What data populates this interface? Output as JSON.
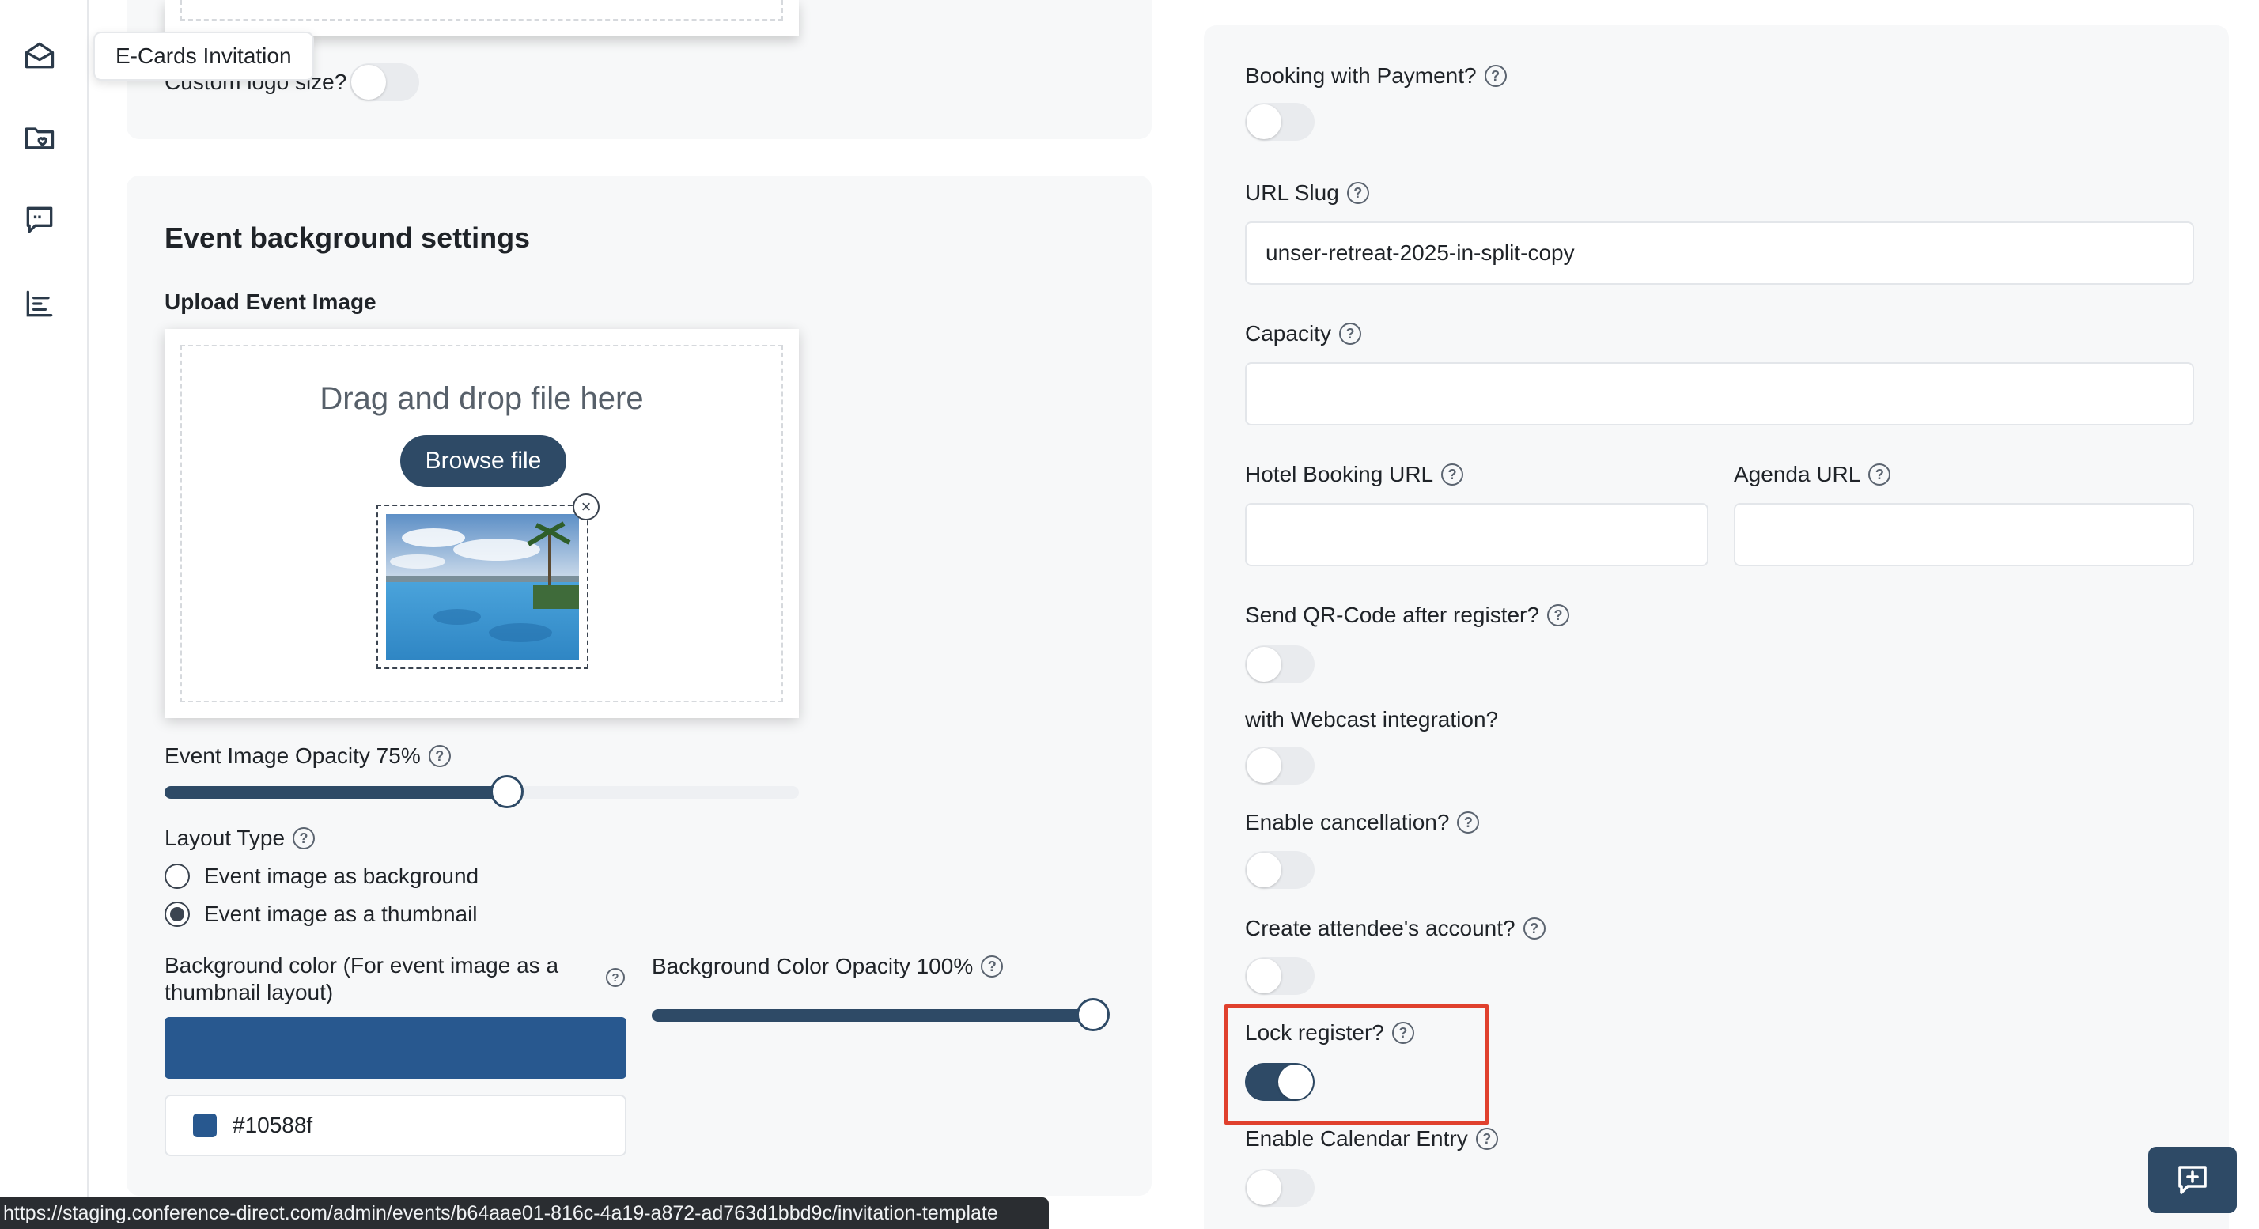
{
  "sidebar": {
    "tooltip": "E-Cards Invitation",
    "icons": [
      "envelope-open-icon",
      "folder-heart-icon",
      "chat-quote-icon",
      "chart-bars-icon"
    ]
  },
  "top_card": {
    "custom_logo_label": "Custom logo size?",
    "custom_logo_on": false
  },
  "background": {
    "title": "Event background settings",
    "upload_label": "Upload Event Image",
    "drop_text": "Drag and drop file here",
    "browse_label": "Browse file",
    "opacity_label": "Event Image Opacity 75%",
    "opacity_value": 75,
    "layout_label": "Layout Type",
    "layout_options": [
      "Event image as background",
      "Event image as a thumbnail"
    ],
    "layout_selected": 1,
    "bg_color_label": "Background color (For event image as a thumbnail layout)",
    "bg_color_value": "#10588f",
    "bg_color_swatch": "#28588f",
    "bg_opacity_label": "Background Color Opacity 100%",
    "bg_opacity_value": 100
  },
  "right": {
    "booking_payment_label": "Booking with Payment?",
    "booking_payment_on": false,
    "url_slug_label": "URL Slug",
    "url_slug_value": "unser-retreat-2025-in-split-copy",
    "capacity_label": "Capacity",
    "capacity_value": "",
    "hotel_label": "Hotel Booking URL",
    "hotel_value": "",
    "agenda_label": "Agenda URL",
    "agenda_value": "",
    "qr_label": "Send QR-Code after register?",
    "qr_on": false,
    "webcast_label": "with Webcast integration?",
    "webcast_on": false,
    "cancel_label": "Enable cancellation?",
    "cancel_on": false,
    "account_label": "Create attendee's account?",
    "account_on": false,
    "lock_label": "Lock register?",
    "lock_on": true,
    "calendar_label": "Enable Calendar Entry",
    "calendar_on": false
  },
  "status_bar": {
    "url": "https://staging.conference-direct.com/admin/events/b64aae01-816c-4a19-a872-ad763d1bbd9c/invitation-template"
  },
  "colors": {
    "primary": "#2e4a66",
    "highlight": "#e0412e"
  }
}
